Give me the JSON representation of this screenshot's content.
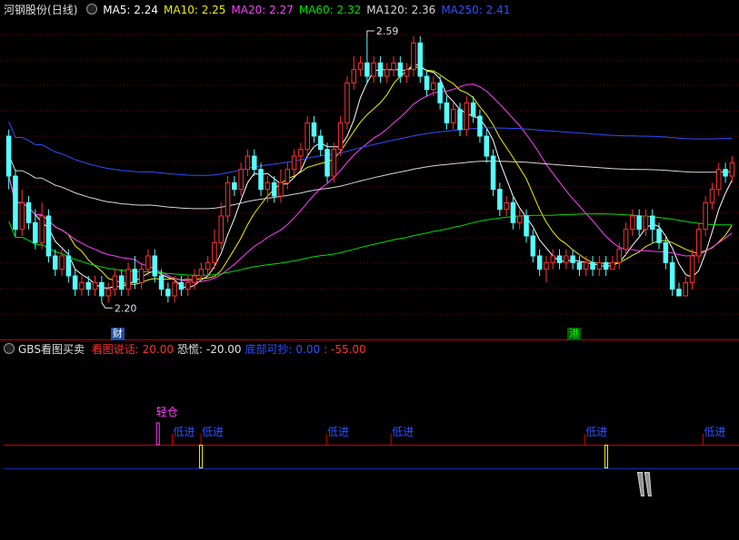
{
  "main_chart": {
    "stock_name": "河钢股份",
    "period": "(日线)",
    "ma_legend": [
      {
        "label": "MA5: 2.24",
        "color": "#ffffff"
      },
      {
        "label": "MA10: 2.25",
        "color": "#f0f000"
      },
      {
        "label": "MA20: 2.27",
        "color": "#ff40ff"
      },
      {
        "label": "MA60: 2.32",
        "color": "#00e000"
      },
      {
        "label": "MA120: 2.36",
        "color": "#d8d8d8"
      },
      {
        "label": "MA250: 2.41",
        "color": "#3050ff"
      }
    ],
    "high_label": "2.59",
    "low_label": "2.20",
    "event_badges": [
      {
        "text": "港",
        "color": "#00ff00",
        "bg": "#006000"
      },
      {
        "text": "财",
        "color": "#ffffff",
        "bg": "#2050a0"
      }
    ]
  },
  "indicator": {
    "name": "GBS看图买卖",
    "params": [
      {
        "label": "看图说话: 20.00",
        "color": "#ff3030"
      },
      {
        "label": "恐慌: -20.00",
        "color": "#e0e0e0"
      },
      {
        "label": "底部可抄: 0.00",
        "color": "#3050ff"
      },
      {
        "label": ": -55.00",
        "color": "#ff3030"
      }
    ],
    "signals": {
      "light_position": "轻仓",
      "low_entry": "低进"
    },
    "colors": {
      "red_line": "#d00000",
      "blue_line": "#1030a0",
      "magenta": "#ff40ff",
      "yellow": "#f0f000",
      "signal_text": "#3050ff"
    }
  },
  "chart_data": {
    "type": "candlestick",
    "title": "",
    "y_range": [
      2.17,
      2.62
    ],
    "candles": [
      [
        2.44,
        2.38,
        2.45,
        2.36
      ],
      [
        2.38,
        2.3,
        2.39,
        2.29
      ],
      [
        2.3,
        2.34,
        2.36,
        2.29
      ],
      [
        2.34,
        2.31,
        2.35,
        2.3
      ],
      [
        2.31,
        2.28,
        2.33,
        2.27
      ],
      [
        2.28,
        2.32,
        2.34,
        2.27
      ],
      [
        2.32,
        2.26,
        2.33,
        2.25
      ],
      [
        2.26,
        2.24,
        2.27,
        2.23
      ],
      [
        2.24,
        2.26,
        2.27,
        2.23
      ],
      [
        2.26,
        2.23,
        2.27,
        2.22
      ],
      [
        2.23,
        2.21,
        2.24,
        2.2
      ],
      [
        2.21,
        2.22,
        2.23,
        2.2
      ],
      [
        2.22,
        2.21,
        2.23,
        2.2
      ],
      [
        2.21,
        2.22,
        2.23,
        2.2
      ],
      [
        2.22,
        2.2,
        2.23,
        2.19
      ],
      [
        2.2,
        2.21,
        2.22,
        2.19
      ],
      [
        2.21,
        2.23,
        2.24,
        2.2
      ],
      [
        2.23,
        2.21,
        2.24,
        2.2
      ],
      [
        2.21,
        2.24,
        2.25,
        2.2
      ],
      [
        2.24,
        2.22,
        2.26,
        2.21
      ],
      [
        2.22,
        2.24,
        2.25,
        2.21
      ],
      [
        2.24,
        2.26,
        2.27,
        2.23
      ],
      [
        2.26,
        2.23,
        2.27,
        2.22
      ],
      [
        2.23,
        2.21,
        2.24,
        2.2
      ],
      [
        2.21,
        2.2,
        2.22,
        2.19
      ],
      [
        2.2,
        2.22,
        2.23,
        2.19
      ],
      [
        2.22,
        2.21,
        2.23,
        2.2
      ],
      [
        2.21,
        2.22,
        2.23,
        2.2
      ],
      [
        2.22,
        2.23,
        2.24,
        2.21
      ],
      [
        2.23,
        2.24,
        2.25,
        2.22
      ],
      [
        2.24,
        2.25,
        2.26,
        2.23
      ],
      [
        2.25,
        2.28,
        2.3,
        2.24
      ],
      [
        2.28,
        2.32,
        2.34,
        2.27
      ],
      [
        2.32,
        2.37,
        2.38,
        2.31
      ],
      [
        2.37,
        2.36,
        2.38,
        2.35
      ],
      [
        2.36,
        2.39,
        2.4,
        2.35
      ],
      [
        2.39,
        2.41,
        2.42,
        2.38
      ],
      [
        2.41,
        2.39,
        2.42,
        2.38
      ],
      [
        2.39,
        2.36,
        2.4,
        2.35
      ],
      [
        2.36,
        2.37,
        2.38,
        2.34
      ],
      [
        2.37,
        2.35,
        2.38,
        2.34
      ],
      [
        2.35,
        2.37,
        2.39,
        2.34
      ],
      [
        2.37,
        2.39,
        2.4,
        2.36
      ],
      [
        2.39,
        2.41,
        2.42,
        2.38
      ],
      [
        2.41,
        2.42,
        2.43,
        2.39
      ],
      [
        2.42,
        2.46,
        2.47,
        2.41
      ],
      [
        2.46,
        2.44,
        2.47,
        2.43
      ],
      [
        2.44,
        2.42,
        2.45,
        2.41
      ],
      [
        2.42,
        2.38,
        2.43,
        2.37
      ],
      [
        2.38,
        2.42,
        2.43,
        2.37
      ],
      [
        2.42,
        2.46,
        2.47,
        2.41
      ],
      [
        2.46,
        2.52,
        2.53,
        2.45
      ],
      [
        2.52,
        2.54,
        2.56,
        2.51
      ],
      [
        2.54,
        2.55,
        2.56,
        2.53
      ],
      [
        2.55,
        2.53,
        2.59,
        2.52
      ],
      [
        2.53,
        2.55,
        2.56,
        2.52
      ],
      [
        2.55,
        2.53,
        2.56,
        2.52
      ],
      [
        2.53,
        2.54,
        2.55,
        2.52
      ],
      [
        2.54,
        2.55,
        2.56,
        2.53
      ],
      [
        2.55,
        2.53,
        2.56,
        2.52
      ],
      [
        2.53,
        2.54,
        2.55,
        2.52
      ],
      [
        2.54,
        2.58,
        2.59,
        2.53
      ],
      [
        2.58,
        2.53,
        2.59,
        2.52
      ],
      [
        2.53,
        2.51,
        2.54,
        2.5
      ],
      [
        2.51,
        2.52,
        2.53,
        2.5
      ],
      [
        2.52,
        2.49,
        2.53,
        2.48
      ],
      [
        2.49,
        2.46,
        2.5,
        2.45
      ],
      [
        2.46,
        2.48,
        2.49,
        2.45
      ],
      [
        2.48,
        2.45,
        2.49,
        2.44
      ],
      [
        2.45,
        2.49,
        2.5,
        2.44
      ],
      [
        2.49,
        2.47,
        2.5,
        2.46
      ],
      [
        2.47,
        2.44,
        2.48,
        2.43
      ],
      [
        2.44,
        2.41,
        2.45,
        2.4
      ],
      [
        2.41,
        2.36,
        2.42,
        2.35
      ],
      [
        2.36,
        2.33,
        2.37,
        2.32
      ],
      [
        2.33,
        2.34,
        2.35,
        2.32
      ],
      [
        2.34,
        2.31,
        2.35,
        2.3
      ],
      [
        2.31,
        2.32,
        2.33,
        2.3
      ],
      [
        2.32,
        2.29,
        2.33,
        2.28
      ],
      [
        2.29,
        2.26,
        2.3,
        2.25
      ],
      [
        2.26,
        2.24,
        2.27,
        2.23
      ],
      [
        2.24,
        2.25,
        2.26,
        2.22
      ],
      [
        2.25,
        2.26,
        2.27,
        2.24
      ],
      [
        2.26,
        2.25,
        2.27,
        2.24
      ],
      [
        2.25,
        2.26,
        2.27,
        2.24
      ],
      [
        2.26,
        2.25,
        2.27,
        2.24
      ],
      [
        2.25,
        2.24,
        2.26,
        2.23
      ],
      [
        2.24,
        2.25,
        2.26,
        2.23
      ],
      [
        2.25,
        2.24,
        2.26,
        2.23
      ],
      [
        2.24,
        2.25,
        2.26,
        2.23
      ],
      [
        2.25,
        2.24,
        2.26,
        2.23
      ],
      [
        2.24,
        2.25,
        2.26,
        2.24
      ],
      [
        2.25,
        2.27,
        2.28,
        2.24
      ],
      [
        2.27,
        2.3,
        2.31,
        2.26
      ],
      [
        2.3,
        2.32,
        2.33,
        2.29
      ],
      [
        2.32,
        2.3,
        2.33,
        2.29
      ],
      [
        2.3,
        2.32,
        2.33,
        2.29
      ],
      [
        2.32,
        2.3,
        2.33,
        2.28
      ],
      [
        2.3,
        2.28,
        2.31,
        2.27
      ],
      [
        2.28,
        2.25,
        2.29,
        2.24
      ],
      [
        2.25,
        2.21,
        2.26,
        2.2
      ],
      [
        2.21,
        2.2,
        2.22,
        2.2
      ],
      [
        2.2,
        2.22,
        2.23,
        2.2
      ],
      [
        2.22,
        2.26,
        2.27,
        2.21
      ],
      [
        2.26,
        2.3,
        2.31,
        2.25
      ],
      [
        2.3,
        2.34,
        2.35,
        2.29
      ],
      [
        2.34,
        2.36,
        2.37,
        2.33
      ],
      [
        2.36,
        2.39,
        2.4,
        2.35
      ],
      [
        2.39,
        2.38,
        2.4,
        2.37
      ],
      [
        2.38,
        2.4,
        2.41,
        2.37
      ]
    ],
    "events": {
      "light_position": [
        43
      ],
      "low_entry": [
        47,
        55,
        90,
        108,
        162,
        195
      ],
      "yellow_bars": [
        55,
        168
      ],
      "panic_bars": [
        178,
        180
      ]
    }
  }
}
